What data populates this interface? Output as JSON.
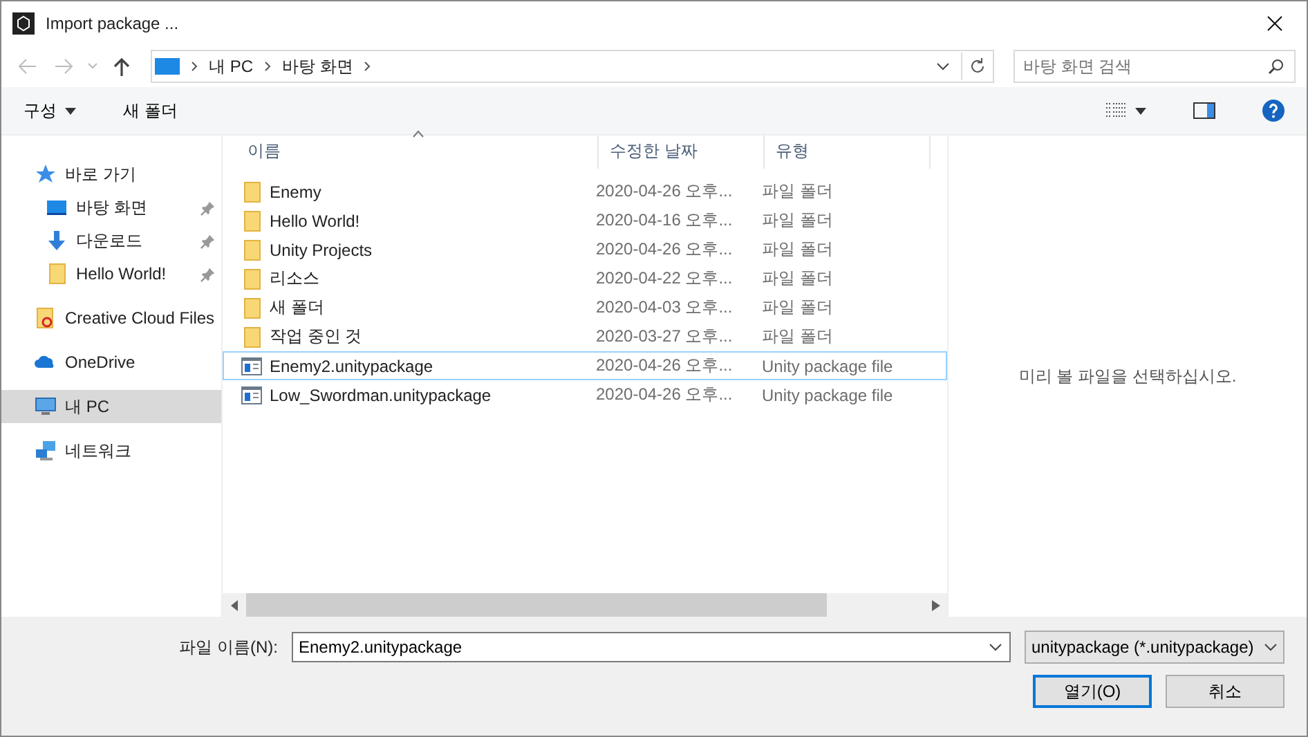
{
  "window": {
    "title": "Import package ..."
  },
  "address_bar": {
    "crumbs": [
      "내 PC",
      "바탕 화면"
    ]
  },
  "search": {
    "placeholder": "바탕 화면 검색"
  },
  "toolbar": {
    "organize": "구성",
    "new_folder": "새 폴더"
  },
  "sidebar": {
    "items": [
      {
        "label": "바로 가기",
        "kind": "star",
        "selected": false,
        "children": [
          {
            "label": "바탕 화면",
            "kind": "desktop",
            "pinned": true,
            "selected": false
          },
          {
            "label": "다운로드",
            "kind": "download",
            "pinned": true,
            "selected": false
          },
          {
            "label": "Hello World!",
            "kind": "folder",
            "pinned": true,
            "selected": false
          }
        ]
      },
      {
        "label": "Creative Cloud Files",
        "kind": "ccfolder",
        "selected": false
      },
      {
        "label": "OneDrive",
        "kind": "cloud",
        "selected": false
      },
      {
        "label": "내 PC",
        "kind": "pc",
        "selected": true
      },
      {
        "label": "네트워크",
        "kind": "network",
        "selected": false
      }
    ]
  },
  "table": {
    "columns": [
      "이름",
      "수정한 날짜",
      "유형"
    ],
    "rows": [
      {
        "kind": "folder",
        "name": "Enemy",
        "date": "2020-04-26 오후...",
        "type": "파일 폴더",
        "selected": false
      },
      {
        "kind": "folder",
        "name": "Hello World!",
        "date": "2020-04-16 오후...",
        "type": "파일 폴더",
        "selected": false
      },
      {
        "kind": "folder",
        "name": "Unity Projects",
        "date": "2020-04-26 오후...",
        "type": "파일 폴더",
        "selected": false
      },
      {
        "kind": "folder",
        "name": "리소스",
        "date": "2020-04-22 오후...",
        "type": "파일 폴더",
        "selected": false
      },
      {
        "kind": "folder",
        "name": "새 폴더",
        "date": "2020-04-03 오후...",
        "type": "파일 폴더",
        "selected": false
      },
      {
        "kind": "folder",
        "name": "작업 중인 것",
        "date": "2020-03-27 오후...",
        "type": "파일 폴더",
        "selected": false
      },
      {
        "kind": "package",
        "name": "Enemy2.unitypackage",
        "date": "2020-04-26 오후...",
        "type": "Unity package file",
        "selected": true
      },
      {
        "kind": "package",
        "name": "Low_Swordman.unitypackage",
        "date": "2020-04-26 오후...",
        "type": "Unity package file",
        "selected": false
      }
    ]
  },
  "preview": {
    "message": "미리 볼 파일을 선택하십시오."
  },
  "footer": {
    "filename_label": "파일 이름(N):",
    "filename": "Enemy2.unitypackage",
    "filter": "unitypackage (*.unitypackage)",
    "open": "열기(O)",
    "cancel": "취소"
  }
}
